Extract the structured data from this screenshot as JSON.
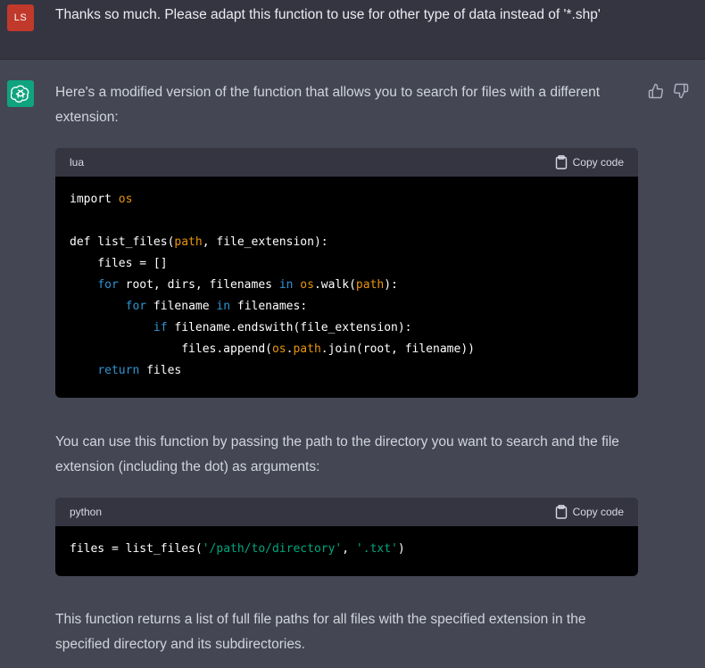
{
  "user_message": {
    "avatar_initials": "LS",
    "text": "Thanks so much. Please adapt this function to use for other type of data instead of '*.shp'"
  },
  "assistant_message": {
    "intro": "Here's a modified version of the function that allows you to search for files with a different extension:",
    "middle": "You can use this function by passing the path to the directory you want to search and the file extension (including the dot) as arguments:",
    "outro": "This function returns a list of full file paths for all files with the specified extension in the specified directory and its subdirectories."
  },
  "code_blocks": [
    {
      "language": "lua",
      "copy_label": "Copy code",
      "lines": [
        [
          {
            "t": "import ",
            "c": ""
          },
          {
            "t": "os",
            "c": "id"
          }
        ],
        [],
        [
          {
            "t": "def list_files(",
            "c": ""
          },
          {
            "t": "path",
            "c": "id"
          },
          {
            "t": ", file_extension):",
            "c": ""
          }
        ],
        [
          {
            "t": "    files = []",
            "c": ""
          }
        ],
        [
          {
            "t": "    ",
            "c": ""
          },
          {
            "t": "for",
            "c": "kw"
          },
          {
            "t": " root, dirs, filenames ",
            "c": ""
          },
          {
            "t": "in",
            "c": "kw"
          },
          {
            "t": " ",
            "c": ""
          },
          {
            "t": "os",
            "c": "id"
          },
          {
            "t": ".walk(",
            "c": ""
          },
          {
            "t": "path",
            "c": "id"
          },
          {
            "t": "):",
            "c": ""
          }
        ],
        [
          {
            "t": "        ",
            "c": ""
          },
          {
            "t": "for",
            "c": "kw"
          },
          {
            "t": " filename ",
            "c": ""
          },
          {
            "t": "in",
            "c": "kw"
          },
          {
            "t": " filenames:",
            "c": ""
          }
        ],
        [
          {
            "t": "            ",
            "c": ""
          },
          {
            "t": "if",
            "c": "kw"
          },
          {
            "t": " filename.endswith(file_extension):",
            "c": ""
          }
        ],
        [
          {
            "t": "                files.append(",
            "c": ""
          },
          {
            "t": "os",
            "c": "id"
          },
          {
            "t": ".",
            "c": ""
          },
          {
            "t": "path",
            "c": "id"
          },
          {
            "t": ".join(root, filename))",
            "c": ""
          }
        ],
        [
          {
            "t": "    ",
            "c": ""
          },
          {
            "t": "return",
            "c": "kw"
          },
          {
            "t": " files",
            "c": ""
          }
        ]
      ]
    },
    {
      "language": "python",
      "copy_label": "Copy code",
      "lines": [
        [
          {
            "t": "files = list_files(",
            "c": ""
          },
          {
            "t": "'/path/to/directory'",
            "c": "str"
          },
          {
            "t": ", ",
            "c": ""
          },
          {
            "t": "'.txt'",
            "c": "str"
          },
          {
            "t": ")",
            "c": ""
          }
        ]
      ]
    }
  ],
  "icons": {
    "user_avatar": "initials-avatar",
    "assistant_avatar": "openai-logo-icon",
    "feedback_up": "thumbs-up-icon",
    "feedback_down": "thumbs-down-icon",
    "copy": "clipboard-icon"
  },
  "colors": {
    "user_avatar_bg": "#c0392b",
    "assistant_avatar_bg": "#10a37f",
    "keyword": "#2e95d3",
    "identifier": "#e9950c",
    "string": "#00a67d"
  }
}
